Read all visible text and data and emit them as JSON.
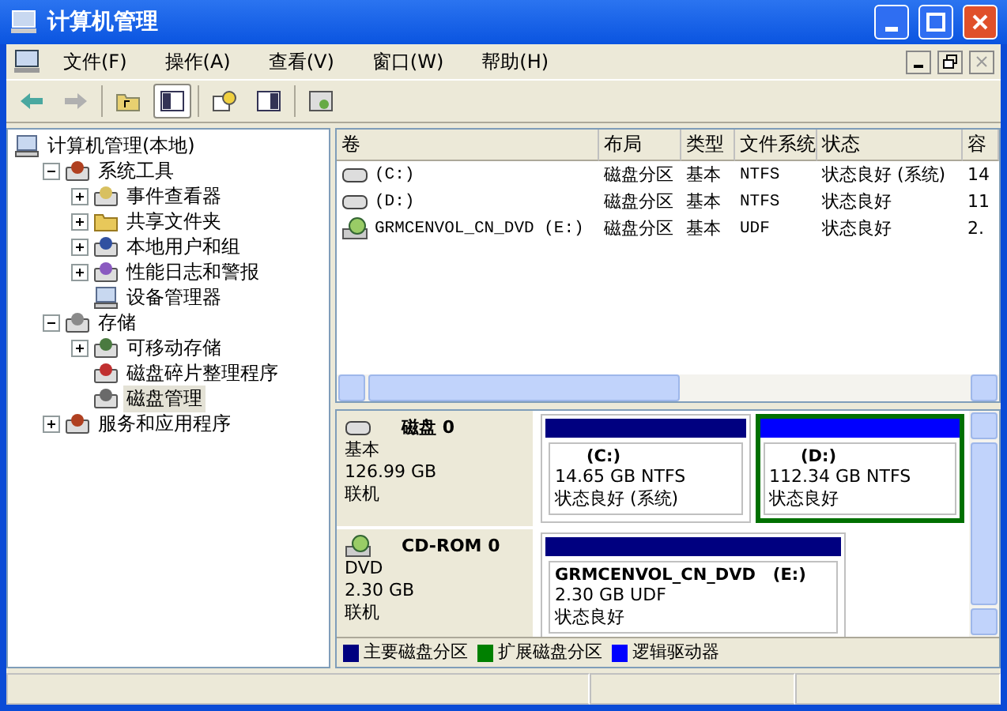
{
  "window": {
    "title": "计算机管理"
  },
  "menu": [
    {
      "label": "文件",
      "key": "(F)"
    },
    {
      "label": "操作",
      "key": "(A)"
    },
    {
      "label": "查看",
      "key": "(V)"
    },
    {
      "label": "窗口",
      "key": "(W)"
    },
    {
      "label": "帮助",
      "key": "(H)"
    }
  ],
  "tree": {
    "label": "计算机管理(本地)",
    "kind": "computer",
    "selected": false,
    "children": [
      {
        "label": "系统工具",
        "kind": "tools",
        "expanded": true,
        "selected": false,
        "children": [
          {
            "label": "事件查看器",
            "kind": "log",
            "expanded": false,
            "selected": false
          },
          {
            "label": "共享文件夹",
            "kind": "folder",
            "expanded": false,
            "selected": false
          },
          {
            "label": "本地用户和组",
            "kind": "users",
            "expanded": false,
            "selected": false
          },
          {
            "label": "性能日志和警报",
            "kind": "chart",
            "expanded": false,
            "selected": false
          },
          {
            "label": "设备管理器",
            "kind": "computer",
            "selected": false
          }
        ]
      },
      {
        "label": "存储",
        "kind": "storage",
        "expanded": true,
        "selected": false,
        "children": [
          {
            "label": "可移动存储",
            "kind": "removable",
            "expanded": false,
            "selected": false
          },
          {
            "label": "磁盘碎片整理程序",
            "kind": "defrag",
            "selected": false
          },
          {
            "label": "磁盘管理",
            "kind": "disk",
            "selected": true
          }
        ]
      },
      {
        "label": "服务和应用程序",
        "kind": "tools",
        "expanded": false,
        "selected": false
      }
    ]
  },
  "volumes": {
    "columns": [
      "卷",
      "布局",
      "类型",
      "文件系统",
      "状态",
      "容"
    ],
    "rows": [
      {
        "kind": "hdd",
        "cells": [
          "(C:)",
          "磁盘分区",
          "基本",
          "NTFS",
          "状态良好 (系统)",
          "14"
        ]
      },
      {
        "kind": "hdd",
        "cells": [
          "(D:)",
          "磁盘分区",
          "基本",
          "NTFS",
          "状态良好",
          "11"
        ]
      },
      {
        "kind": "cd",
        "cells": [
          "GRMCENVOL_CN_DVD (E:)",
          "磁盘分区",
          "基本",
          "UDF",
          "状态良好",
          "2."
        ]
      }
    ]
  },
  "disks": [
    {
      "kind": "hdd",
      "name": "磁盘 0",
      "lines": [
        "基本",
        "126.99 GB",
        "联机"
      ],
      "partitions": [
        {
          "title": "(C:)",
          "lines": [
            "14.65 GB NTFS",
            "状态良好 (系统)"
          ],
          "color": "#000080",
          "selected": false
        },
        {
          "title": "(D:)",
          "lines": [
            "112.34 GB NTFS",
            "状态良好"
          ],
          "color": "#0000ff",
          "selected": true
        }
      ]
    },
    {
      "kind": "cd",
      "name": "CD-ROM 0",
      "lines": [
        "DVD",
        "2.30 GB",
        "联机"
      ],
      "partitions": [
        {
          "title": "GRMCENVOL_CN_DVD   (E:)",
          "lines": [
            "2.30 GB UDF",
            "状态良好"
          ],
          "color": "#000080",
          "selected": false
        }
      ]
    }
  ],
  "legend": [
    {
      "label": "主要磁盘分区",
      "color": "#000080"
    },
    {
      "label": "扩展磁盘分区",
      "color": "#008000"
    },
    {
      "label": "逻辑驱动器",
      "color": "#0000ff"
    }
  ]
}
